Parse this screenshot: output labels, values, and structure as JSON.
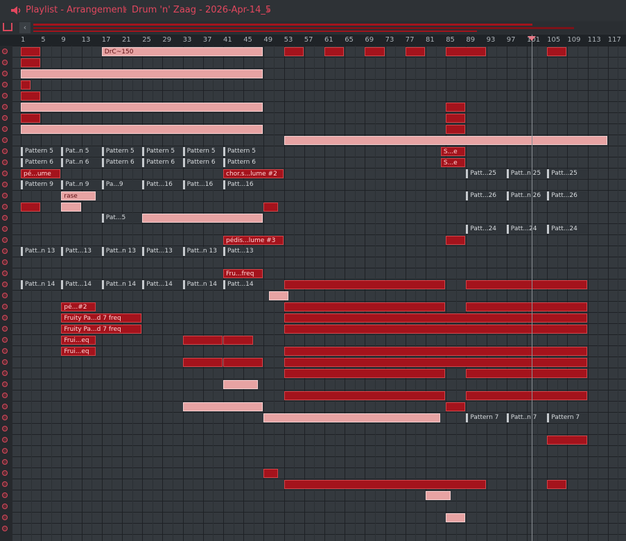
{
  "window": {
    "title": "Playlist - Arrangement",
    "pattern": "Drum 'n' Zaag - 2026-Apr-14_5"
  },
  "ruler": {
    "bars": [
      "1",
      "5",
      "9",
      "13",
      "17",
      "21",
      "25",
      "29",
      "33",
      "37",
      "41",
      "45",
      "49",
      "53",
      "57",
      "61",
      "65",
      "69",
      "73",
      "77",
      "81",
      "85",
      "89",
      "93",
      "97",
      "101",
      "105",
      "109",
      "113",
      "117"
    ]
  },
  "playhead": {
    "bar": 102
  },
  "colors": {
    "accent": "#e2475e",
    "clip": "#a4131c",
    "grid": "#34393e"
  },
  "clips": [
    {
      "row": 0,
      "start": 1,
      "len": 4,
      "label": "",
      "style": "red"
    },
    {
      "row": 0,
      "start": 17,
      "len": 32,
      "label": "DrC~150",
      "style": "light"
    },
    {
      "row": 0,
      "start": 53,
      "len": 4,
      "label": "",
      "style": "red"
    },
    {
      "row": 0,
      "start": 61,
      "len": 4,
      "label": "",
      "style": "red"
    },
    {
      "row": 0,
      "start": 69,
      "len": 4,
      "label": "",
      "style": "red"
    },
    {
      "row": 0,
      "start": 77,
      "len": 4,
      "label": "",
      "style": "red"
    },
    {
      "row": 0,
      "start": 85,
      "len": 8,
      "label": "",
      "style": "red"
    },
    {
      "row": 0,
      "start": 105,
      "len": 4,
      "label": "",
      "style": "red"
    },
    {
      "row": 1,
      "start": 1,
      "len": 4,
      "label": "",
      "style": "red"
    },
    {
      "row": 2,
      "start": 1,
      "len": 48,
      "label": "",
      "style": "light"
    },
    {
      "row": 3,
      "start": 1,
      "len": 2,
      "label": "",
      "style": "red"
    },
    {
      "row": 4,
      "start": 1,
      "len": 4,
      "label": "",
      "style": "red"
    },
    {
      "row": 5,
      "start": 1,
      "len": 48,
      "label": "",
      "style": "light"
    },
    {
      "row": 5,
      "start": 85,
      "len": 4,
      "label": "",
      "style": "red"
    },
    {
      "row": 6,
      "start": 1,
      "len": 4,
      "label": "",
      "style": "red"
    },
    {
      "row": 6,
      "start": 85,
      "len": 4,
      "label": "",
      "style": "red"
    },
    {
      "row": 7,
      "start": 1,
      "len": 48,
      "label": "",
      "style": "light"
    },
    {
      "row": 7,
      "start": 85,
      "len": 4,
      "label": "",
      "style": "red"
    },
    {
      "row": 8,
      "start": 53,
      "len": 64,
      "label": "",
      "style": "light"
    },
    {
      "row": 9,
      "start": 1,
      "len": 8,
      "label": "Pattern 5",
      "style": "pat"
    },
    {
      "row": 9,
      "start": 9,
      "len": 8,
      "label": "Pat..n 5",
      "style": "pat"
    },
    {
      "row": 9,
      "start": 17,
      "len": 8,
      "label": "Pattern 5",
      "style": "pat"
    },
    {
      "row": 9,
      "start": 25,
      "len": 8,
      "label": "Pattern 5",
      "style": "pat"
    },
    {
      "row": 9,
      "start": 33,
      "len": 8,
      "label": "Pattern 5",
      "style": "pat"
    },
    {
      "row": 9,
      "start": 41,
      "len": 8,
      "label": "Pattern 5",
      "style": "pat"
    },
    {
      "row": 9,
      "start": 84,
      "len": 5,
      "label": "S...e",
      "style": "red"
    },
    {
      "row": 10,
      "start": 1,
      "len": 8,
      "label": "Pattern 6",
      "style": "pat"
    },
    {
      "row": 10,
      "start": 9,
      "len": 8,
      "label": "Pat..n 6",
      "style": "pat"
    },
    {
      "row": 10,
      "start": 17,
      "len": 8,
      "label": "Pattern 6",
      "style": "pat"
    },
    {
      "row": 10,
      "start": 25,
      "len": 8,
      "label": "Pattern 6",
      "style": "pat"
    },
    {
      "row": 10,
      "start": 33,
      "len": 8,
      "label": "Pattern 6",
      "style": "pat"
    },
    {
      "row": 10,
      "start": 41,
      "len": 8,
      "label": "Pattern 6",
      "style": "pat"
    },
    {
      "row": 10,
      "start": 84,
      "len": 5,
      "label": "S...e",
      "style": "red"
    },
    {
      "row": 11,
      "start": 1,
      "len": 8,
      "label": "pé...ume",
      "style": "red"
    },
    {
      "row": 11,
      "start": 41,
      "len": 12,
      "label": "chor.s...lume #2",
      "style": "red"
    },
    {
      "row": 11,
      "start": 89,
      "len": 8,
      "label": "Patt...25",
      "style": "pat"
    },
    {
      "row": 11,
      "start": 97,
      "len": 8,
      "label": "Patt..n 25",
      "style": "pat"
    },
    {
      "row": 11,
      "start": 105,
      "len": 8,
      "label": "Patt...25",
      "style": "pat"
    },
    {
      "row": 12,
      "start": 1,
      "len": 8,
      "label": "Pattern 9",
      "style": "pat"
    },
    {
      "row": 12,
      "start": 9,
      "len": 8,
      "label": "Pat..n 9",
      "style": "pat"
    },
    {
      "row": 12,
      "start": 17,
      "len": 8,
      "label": "Pa...9",
      "style": "pat"
    },
    {
      "row": 12,
      "start": 25,
      "len": 8,
      "label": "Patt...16",
      "style": "pat"
    },
    {
      "row": 12,
      "start": 33,
      "len": 8,
      "label": "Patt...16",
      "style": "pat"
    },
    {
      "row": 12,
      "start": 41,
      "len": 8,
      "label": "Patt...16",
      "style": "pat"
    },
    {
      "row": 13,
      "start": 9,
      "len": 7,
      "label": "rase",
      "style": "light"
    },
    {
      "row": 13,
      "start": 89,
      "len": 8,
      "label": "Patt...26",
      "style": "pat"
    },
    {
      "row": 13,
      "start": 97,
      "len": 8,
      "label": "Patt..n 26",
      "style": "pat"
    },
    {
      "row": 13,
      "start": 105,
      "len": 8,
      "label": "Patt...26",
      "style": "pat"
    },
    {
      "row": 14,
      "start": 1,
      "len": 4,
      "label": "",
      "style": "red"
    },
    {
      "row": 14,
      "start": 9,
      "len": 4,
      "label": "",
      "style": "light"
    },
    {
      "row": 14,
      "start": 49,
      "len": 3,
      "label": "",
      "style": "red"
    },
    {
      "row": 15,
      "start": 17,
      "len": 8,
      "label": "Pat...5",
      "style": "pat"
    },
    {
      "row": 15,
      "start": 25,
      "len": 24,
      "label": "",
      "style": "light"
    },
    {
      "row": 16,
      "start": 89,
      "len": 8,
      "label": "Patt...24",
      "style": "pat"
    },
    {
      "row": 16,
      "start": 97,
      "len": 8,
      "label": "Patt...24",
      "style": "pat"
    },
    {
      "row": 16,
      "start": 105,
      "len": 8,
      "label": "Patt...24",
      "style": "pat"
    },
    {
      "row": 17,
      "start": 41,
      "len": 12,
      "label": "pédis...lume #3",
      "style": "red"
    },
    {
      "row": 17,
      "start": 85,
      "len": 4,
      "label": "",
      "style": "red"
    },
    {
      "row": 18,
      "start": 1,
      "len": 8,
      "label": "Patt..n 13",
      "style": "pat"
    },
    {
      "row": 18,
      "start": 9,
      "len": 8,
      "label": "Patt...13",
      "style": "pat"
    },
    {
      "row": 18,
      "start": 17,
      "len": 8,
      "label": "Patt..n 13",
      "style": "pat"
    },
    {
      "row": 18,
      "start": 25,
      "len": 8,
      "label": "Patt...13",
      "style": "pat"
    },
    {
      "row": 18,
      "start": 33,
      "len": 8,
      "label": "Patt..n 13",
      "style": "pat"
    },
    {
      "row": 18,
      "start": 41,
      "len": 8,
      "label": "Patt...13",
      "style": "pat"
    },
    {
      "row": 20,
      "start": 41,
      "len": 8,
      "label": "Fru...freq",
      "style": "red"
    },
    {
      "row": 21,
      "start": 1,
      "len": 8,
      "label": "Patt..n 14",
      "style": "pat"
    },
    {
      "row": 21,
      "start": 9,
      "len": 8,
      "label": "Patt...14",
      "style": "pat"
    },
    {
      "row": 21,
      "start": 17,
      "len": 8,
      "label": "Patt..n 14",
      "style": "pat"
    },
    {
      "row": 21,
      "start": 25,
      "len": 8,
      "label": "Patt...14",
      "style": "pat"
    },
    {
      "row": 21,
      "start": 33,
      "len": 8,
      "label": "Patt..n 14",
      "style": "pat"
    },
    {
      "row": 21,
      "start": 41,
      "len": 8,
      "label": "Patt...14",
      "style": "pat"
    },
    {
      "row": 21,
      "start": 53,
      "len": 32,
      "label": "",
      "style": "red"
    },
    {
      "row": 21,
      "start": 89,
      "len": 24,
      "label": "",
      "style": "red"
    },
    {
      "row": 22,
      "start": 50,
      "len": 4,
      "label": "",
      "style": "light"
    },
    {
      "row": 23,
      "start": 9,
      "len": 7,
      "label": "pé...#2",
      "style": "red"
    },
    {
      "row": 23,
      "start": 53,
      "len": 32,
      "label": "",
      "style": "red"
    },
    {
      "row": 23,
      "start": 89,
      "len": 24,
      "label": "",
      "style": "red"
    },
    {
      "row": 24,
      "start": 9,
      "len": 16,
      "label": "Fruity Pa...d 7 freq",
      "style": "red"
    },
    {
      "row": 24,
      "start": 53,
      "len": 60,
      "label": "",
      "style": "red"
    },
    {
      "row": 25,
      "start": 9,
      "len": 16,
      "label": "Fruity Pa...d 7 freq",
      "style": "red"
    },
    {
      "row": 25,
      "start": 53,
      "len": 60,
      "label": "",
      "style": "red"
    },
    {
      "row": 26,
      "start": 9,
      "len": 7,
      "label": "Frui...eq",
      "style": "red"
    },
    {
      "row": 26,
      "start": 33,
      "len": 8,
      "label": "",
      "style": "red"
    },
    {
      "row": 26,
      "start": 41,
      "len": 6,
      "label": "",
      "style": "red"
    },
    {
      "row": 27,
      "start": 9,
      "len": 7,
      "label": "Frui...eq",
      "style": "red"
    },
    {
      "row": 27,
      "start": 53,
      "len": 60,
      "label": "",
      "style": "red"
    },
    {
      "row": 28,
      "start": 33,
      "len": 8,
      "label": "",
      "style": "red"
    },
    {
      "row": 28,
      "start": 41,
      "len": 8,
      "label": "",
      "style": "red"
    },
    {
      "row": 28,
      "start": 53,
      "len": 60,
      "label": "",
      "style": "red"
    },
    {
      "row": 29,
      "start": 53,
      "len": 32,
      "label": "",
      "style": "red"
    },
    {
      "row": 29,
      "start": 89,
      "len": 24,
      "label": "",
      "style": "red"
    },
    {
      "row": 30,
      "start": 41,
      "len": 7,
      "label": "",
      "style": "light"
    },
    {
      "row": 31,
      "start": 53,
      "len": 32,
      "label": "",
      "style": "red"
    },
    {
      "row": 31,
      "start": 89,
      "len": 24,
      "label": "",
      "style": "red"
    },
    {
      "row": 32,
      "start": 33,
      "len": 16,
      "label": "",
      "style": "light"
    },
    {
      "row": 32,
      "start": 85,
      "len": 4,
      "label": "",
      "style": "red"
    },
    {
      "row": 33,
      "start": 49,
      "len": 35,
      "label": "",
      "style": "light"
    },
    {
      "row": 33,
      "start": 89,
      "len": 8,
      "label": "Pattern 7",
      "style": "pat"
    },
    {
      "row": 33,
      "start": 97,
      "len": 8,
      "label": "Patt..n 7",
      "style": "pat"
    },
    {
      "row": 33,
      "start": 105,
      "len": 8,
      "label": "Pattern 7",
      "style": "pat"
    },
    {
      "row": 35,
      "start": 105,
      "len": 8,
      "label": "",
      "style": "red"
    },
    {
      "row": 38,
      "start": 49,
      "len": 3,
      "label": "",
      "style": "red"
    },
    {
      "row": 39,
      "start": 53,
      "len": 40,
      "label": "",
      "style": "red"
    },
    {
      "row": 39,
      "start": 105,
      "len": 4,
      "label": "",
      "style": "red"
    },
    {
      "row": 40,
      "start": 81,
      "len": 5,
      "label": "",
      "style": "light"
    },
    {
      "row": 42,
      "start": 85,
      "len": 4,
      "label": "",
      "style": "light"
    }
  ]
}
